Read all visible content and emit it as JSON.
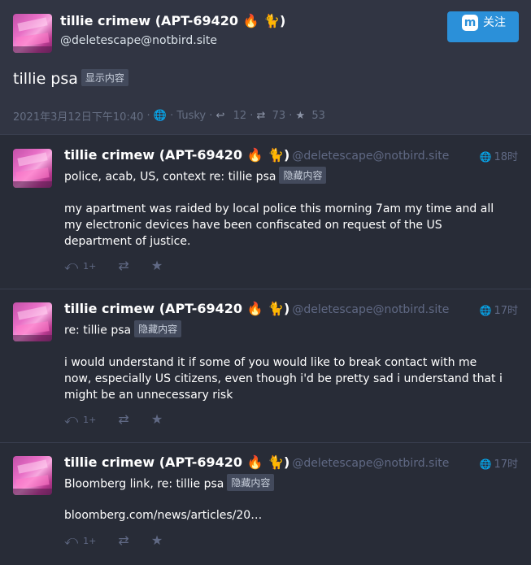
{
  "main": {
    "display_name": "tillie crimew (APT-69420 🔥 🐈)",
    "handle": "@deletescape@notbird.site",
    "follow_label": "关注",
    "follow_icon": "mastodon-icon",
    "cw_text": "tillie psa",
    "cw_button": "显示内容",
    "date": "2021年3月12日下午10:40",
    "visibility_icon": "globe-icon",
    "app": "Tusky",
    "reply_count": "12",
    "boost_count": "73",
    "fav_count": "53"
  },
  "replies": [
    {
      "display_name": "tillie crimew (APT-69420 🔥 🐈)",
      "handle": "@deletescape@notbird.site",
      "time": "18时",
      "cw_text": "police, acab, US, context re: tillie psa",
      "cw_button": "隐藏内容",
      "content": "my apartment was raided by local police this morning 7am my time and all my electronic devices have been confiscated on request of the US department of justice.",
      "reply_count": "1+"
    },
    {
      "display_name": "tillie crimew (APT-69420 🔥 🐈)",
      "handle": "@deletescape@notbird.site",
      "time": "17时",
      "cw_text": "re: tillie psa",
      "cw_button": "隐藏内容",
      "content": "i would understand it if some of you would like to break contact with me now, especially US citizens, even though i'd be pretty sad i understand that i might be an unnecessary risk",
      "reply_count": "1+"
    },
    {
      "display_name": "tillie crimew (APT-69420 🔥 🐈)",
      "handle": "@deletescape@notbird.site",
      "time": "17时",
      "cw_text": "Bloomberg link, re: tillie psa",
      "cw_button": "隐藏内容",
      "content": "bloomberg.com/news/articles/20…",
      "reply_count": "1+"
    }
  ],
  "colors": {
    "background": "#282c37",
    "main_background": "#313543",
    "accent": "#2b90d9",
    "muted": "#606984"
  }
}
